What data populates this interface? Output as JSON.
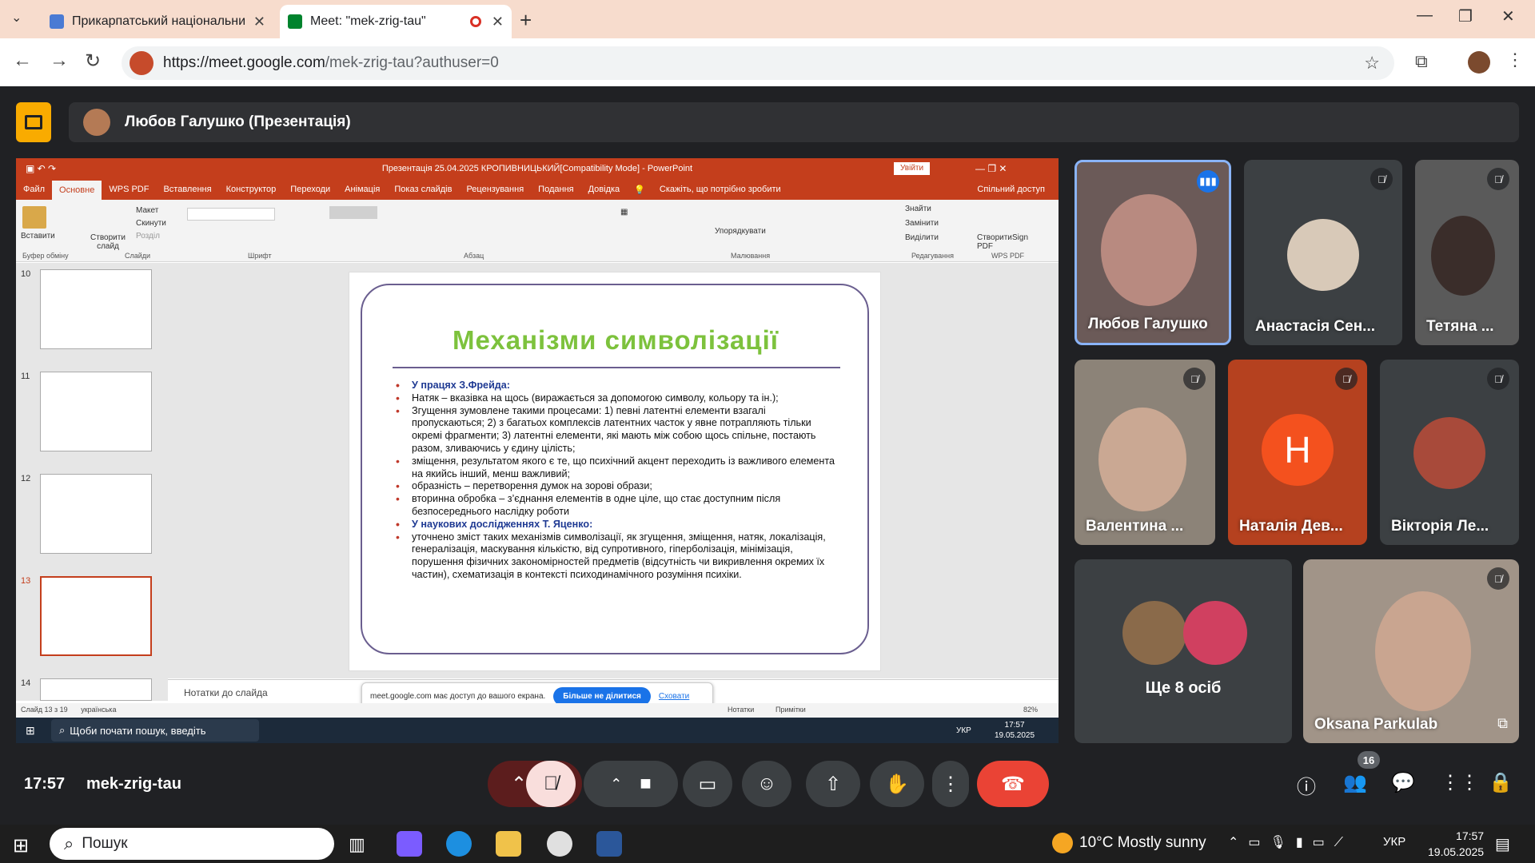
{
  "browser": {
    "tabs": [
      {
        "title": "Прикарпатський національни",
        "favicon_color": "#4a7bd4"
      },
      {
        "title": "Meet: \"mek-zrig-tau\"",
        "favicon_color": "#00832d"
      }
    ],
    "url_domain": "https://meet.google.com",
    "url_path": "/mek-zrig-tau?authuser=0"
  },
  "meet": {
    "presenter_label": "Любов Галушко (Презентація)",
    "time": "17:57",
    "meeting_code": "mek-zrig-tau",
    "participant_count": "16",
    "others_label": "Ще 8 осіб",
    "participants": [
      {
        "name": "Любов Галушко"
      },
      {
        "name": "Анастасія Сен..."
      },
      {
        "name": "Тетяна ..."
      },
      {
        "name": "Валентина ..."
      },
      {
        "name": "Наталія Дев...",
        "initial": "Н"
      },
      {
        "name": "Вікторія Ле..."
      },
      {
        "name": "Oksana Parkulab"
      }
    ]
  },
  "ppt": {
    "window_title": "Презентація 25.04.2025 КРОПИВНИЦЬКИЙ[Compatibility Mode] - PowerPoint",
    "signin": "Увійти",
    "tabs": [
      "Файл",
      "Основне",
      "WPS PDF",
      "Вставлення",
      "Конструктор",
      "Переходи",
      "Анімація",
      "Показ слайдів",
      "Рецензування",
      "Подання",
      "Довідка",
      "Скажіть, що потрібно зробити"
    ],
    "share_label": "Спільний доступ",
    "ribbon": {
      "paste": "Вставити",
      "new_slide": "Створити слайд",
      "layout": "Макет",
      "reset": "Скинути",
      "section": "Розділ",
      "find": "Знайти",
      "replace": "Замінити",
      "select": "Виділити",
      "arrange": "Упорядкувати",
      "create_pdf": "Створити PDF",
      "sign": "Sign",
      "groups": [
        "Буфер обміну",
        "Слайди",
        "Шрифт",
        "Абзац",
        "Малювання",
        "Редагування",
        "WPS PDF"
      ]
    },
    "thumb_numbers": [
      "10",
      "11",
      "12",
      "13",
      "14"
    ],
    "slide": {
      "title": "Механізми символізації",
      "items": [
        {
          "text": "У працях З.Фрейда:",
          "heading": true
        },
        {
          "text": "Натяк – вказівка на щось (виражається за допомогою символу, кольору та ін.);"
        },
        {
          "text": "Згущення зумовлене такими процесами: 1) певні латентні елементи взагалі пропускаються; 2) з багатьох комплексів латентних часток у явне потрапляють тільки окремі фрагменти; 3) латентні елементи, які мають між собою щось спільне, постають разом, зливаючись у єдину цілість;"
        },
        {
          "text": "зміщення, результатом якого є те, що психічний акцент переходить із важливого елемента на якийсь інший, менш важливий;"
        },
        {
          "text": "образність – перетворення думок на зорові образи;"
        },
        {
          "text": "вторинна обробка – з’єднання елементів в одне ціле, що стає доступним після безпосереднього наслідку роботи"
        },
        {
          "text": "У наукових дослідженнях Т. Яценко:",
          "heading": true
        },
        {
          "text": "уточнено зміст таких механізмів символізації, як згущення, зміщення, натяк, локалізація, генералізація, маскування кількістю, від супротивного, гіперболізація, мінімізація, порушення фізичних закономірностей предметів (відсутність чи викривлення окремих їх частин), схематизація в контексті психодинамічного розуміння психіки."
        }
      ]
    },
    "notes_placeholder": "Нотатки до слайда",
    "share_banner": "meet.google.com має доступ до вашого екрана.",
    "stop_sharing": "Більше не ділитися",
    "hide": "Сховати",
    "status_slide": "Слайд 13 з 19",
    "status_lang": "українська",
    "status_notes": "Нотатки",
    "status_comments": "Примітки",
    "zoom": "82%",
    "inner_search": "Щоби почати пошук, введіть",
    "inner_time": "17:57",
    "inner_date": "19.05.2025",
    "inner_lang": "УКР"
  },
  "taskbar": {
    "search_placeholder": "Пошук",
    "weather": "10°C  Mostly sunny",
    "lang": "УКР",
    "time": "17:57",
    "date": "19.05.2025"
  }
}
